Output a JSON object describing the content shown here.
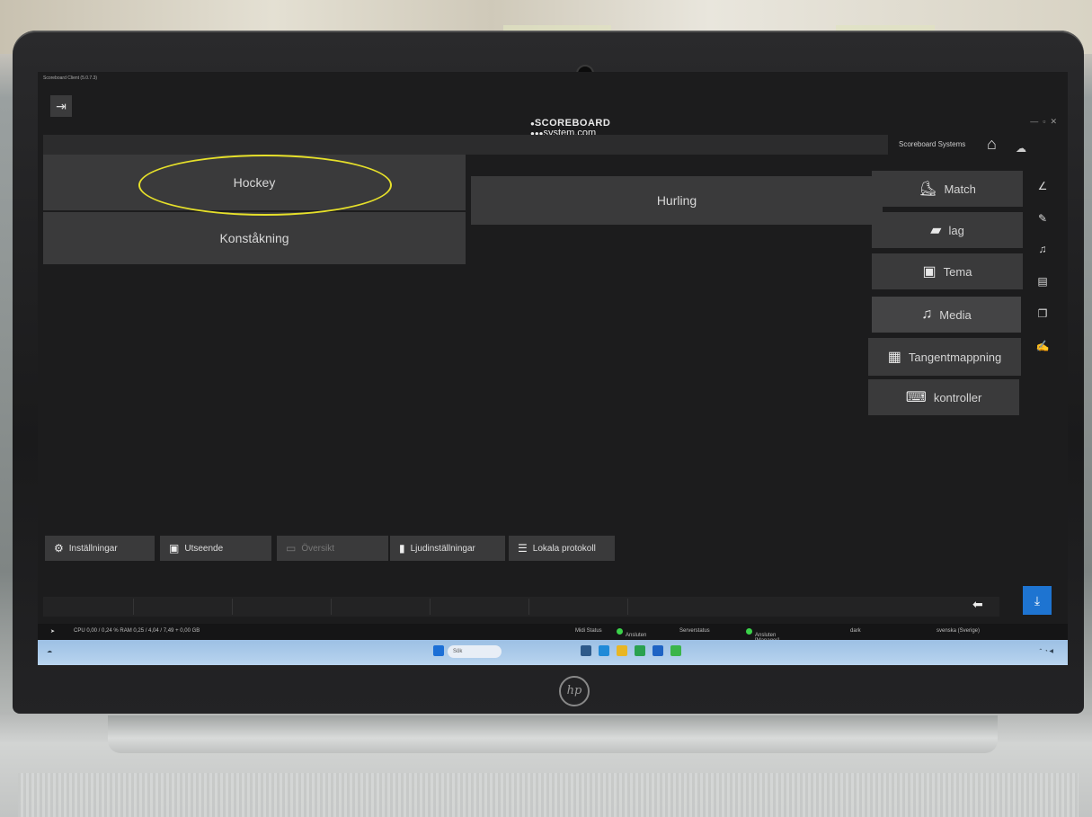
{
  "app": {
    "title": "Scoreboard Client (5.0.7.3)",
    "logo_line1": "SCOREBOARD",
    "logo_line2": "system.com",
    "brand": "Scoreboard Systems"
  },
  "sports": [
    {
      "label": "Hockey"
    },
    {
      "label": "Hurling"
    },
    {
      "label": "Konståkning"
    }
  ],
  "menu": [
    {
      "label": "Match",
      "icon": "skate-icon"
    },
    {
      "label": "lag",
      "icon": "team-icon"
    },
    {
      "label": "Tema",
      "icon": "theme-icon"
    },
    {
      "label": "Media",
      "icon": "media-icon"
    },
    {
      "label": "Tangentmappning",
      "icon": "key-mapping-icon"
    },
    {
      "label": "kontroller",
      "icon": "keyboard-icon"
    }
  ],
  "bottom_tabs": [
    {
      "label": "Inställningar",
      "icon": "settings-icon"
    },
    {
      "label": "Utseende",
      "icon": "appearance-icon"
    },
    {
      "label": "Översikt",
      "icon": "monitor-icon"
    },
    {
      "label": "Ljudinställningar",
      "icon": "audio-icon"
    },
    {
      "label": "Lokala protokoll",
      "icon": "protocol-icon"
    }
  ],
  "status": {
    "cpu": "CPU 0,00 / 0,24 % RAM 0,25 / 4,04 / 7,49 + 0,00 GB",
    "midi_label": "Midi Status",
    "midi_value": "Ansluten",
    "server_label": "Serverstatus",
    "server_value": "Ansluten [Manager]",
    "theme": "dark",
    "locale": "svenska (Sverige)"
  },
  "taskbar": {
    "search": "Sök"
  },
  "annotation_color": "#e6e02a"
}
